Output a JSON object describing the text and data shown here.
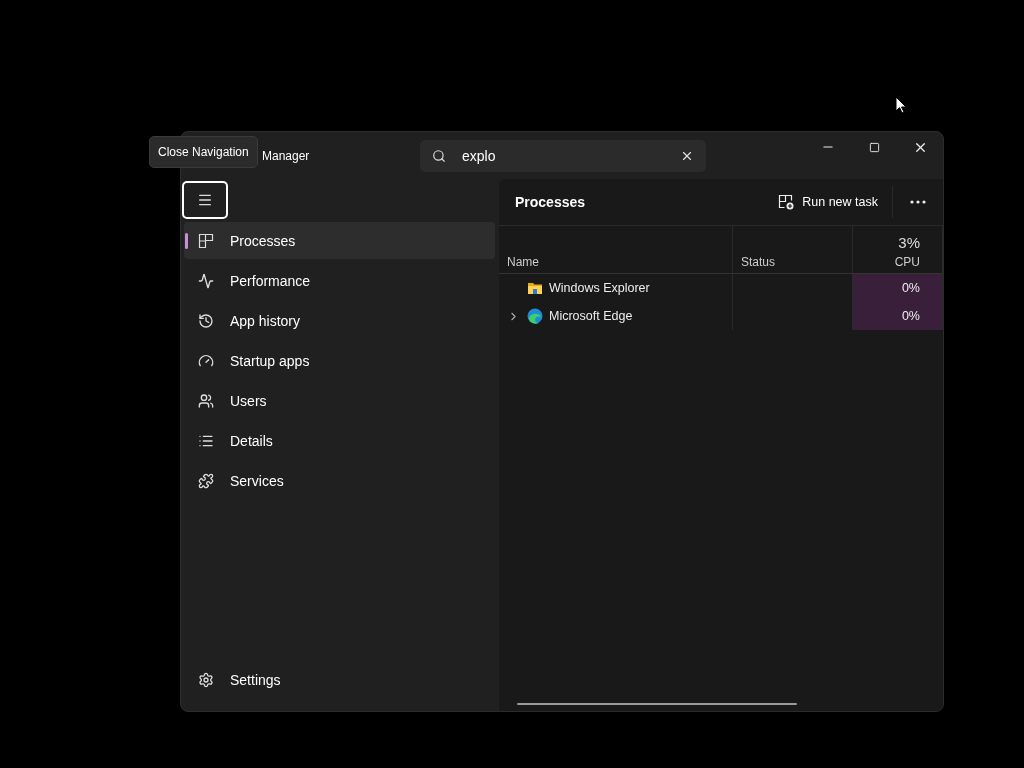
{
  "window": {
    "title": "Manager",
    "tooltip": "Close Navigation"
  },
  "search": {
    "value": "explo"
  },
  "nav": {
    "items": [
      {
        "label": "Processes",
        "selected": true
      },
      {
        "label": "Performance",
        "selected": false
      },
      {
        "label": "App history",
        "selected": false
      },
      {
        "label": "Startup apps",
        "selected": false
      },
      {
        "label": "Users",
        "selected": false
      },
      {
        "label": "Details",
        "selected": false
      },
      {
        "label": "Services",
        "selected": false
      }
    ],
    "footer": {
      "label": "Settings"
    }
  },
  "page": {
    "title": "Processes",
    "action": "Run new task"
  },
  "table": {
    "columns": [
      {
        "label": "Name"
      },
      {
        "label": "Status"
      },
      {
        "label": "CPU",
        "total": "3%"
      }
    ],
    "rows": [
      {
        "name": "Windows Explorer",
        "has_children": false,
        "cpu": "0%"
      },
      {
        "name": "Microsoft Edge",
        "has_children": true,
        "cpu": "0%"
      }
    ]
  }
}
